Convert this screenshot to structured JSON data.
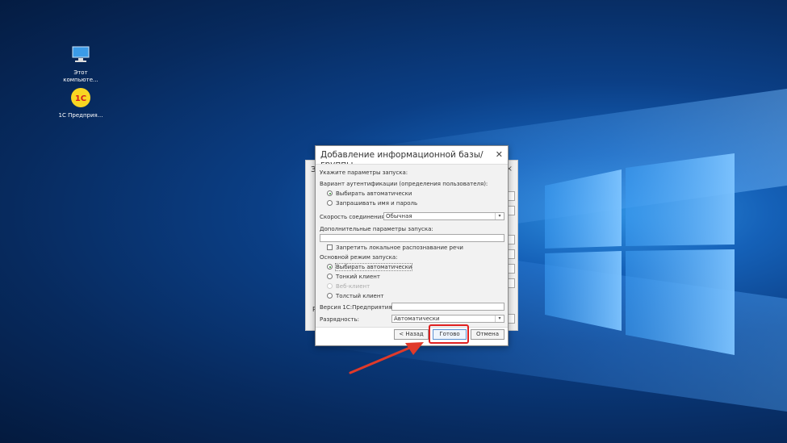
{
  "desktop": {
    "icons": [
      {
        "label": "Этот компьюте...",
        "icon": "computer-icon"
      },
      {
        "label": "1С Предприя...",
        "icon": "1c-enterprise-icon"
      }
    ]
  },
  "background_window": {
    "title_initial": "З",
    "row_initial": "Р"
  },
  "dialog": {
    "title": "Добавление информационной базы/группы",
    "intro": "Укажите параметры запуска:",
    "auth_label": "Вариант аутентификации (определения пользователя):",
    "auth_options": [
      "Выбирать автоматически",
      "Запрашивать имя и пароль"
    ],
    "auth_selected": 0,
    "speed_label": "Скорость соединения:",
    "speed_value": "Обычная",
    "extra_params_label": "Дополнительные параметры запуска:",
    "extra_params_value": "",
    "disable_speech_label": "Запретить локальное распознавание речи",
    "mode_label": "Основной режим запуска:",
    "mode_options": [
      "Выбирать автоматически",
      "Тонкий клиент",
      "Веб-клиент",
      "Толстый клиент"
    ],
    "mode_selected": 0,
    "version_label": "Версия 1С:Предприятия:",
    "version_value": "",
    "bitness_label": "Разрядность:",
    "bitness_value": "Автоматически",
    "buttons": {
      "back": "< Назад",
      "finish": "Готово",
      "cancel": "Отмена"
    }
  },
  "colors": {
    "highlight": "#e02020",
    "accent_radio": "#2a8a2a"
  }
}
